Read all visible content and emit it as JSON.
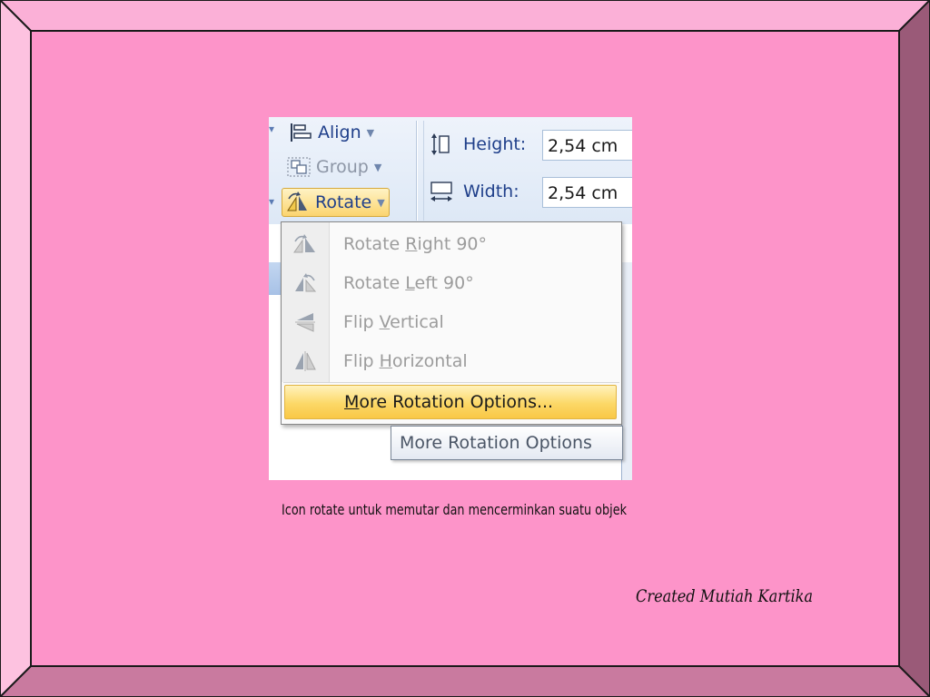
{
  "ribbon": {
    "align_label": "Align",
    "group_label": "Group",
    "rotate_label": "Rotate",
    "height_label": "Height:",
    "height_value": "2,54 cm",
    "width_label": "Width:",
    "width_value": "2,54 cm"
  },
  "menu": {
    "items": [
      {
        "pre": "Rotate ",
        "key": "R",
        "post": "ight 90°",
        "icon": "rotate-right-icon"
      },
      {
        "pre": "Rotate ",
        "key": "L",
        "post": "eft 90°",
        "icon": "rotate-left-icon"
      },
      {
        "pre": "Flip ",
        "key": "V",
        "post": "ertical",
        "icon": "flip-vertical-icon"
      },
      {
        "pre": "Flip ",
        "key": "H",
        "post": "orizontal",
        "icon": "flip-horizontal-icon"
      }
    ],
    "more": {
      "key": "M",
      "post": "ore Rotation Options..."
    }
  },
  "tooltip": "More Rotation Options",
  "caption": "Icon rotate untuk memutar dan mencerminkan suatu objek",
  "credit": "Created Mutiah Kartika",
  "colors": {
    "slide_bg": "#fd94c9",
    "frame_top": "#fbb0d7",
    "frame_left": "#fdc2e0",
    "frame_right": "#9a5a78",
    "frame_bottom": "#c97a9f",
    "highlight": "#fcd867"
  }
}
